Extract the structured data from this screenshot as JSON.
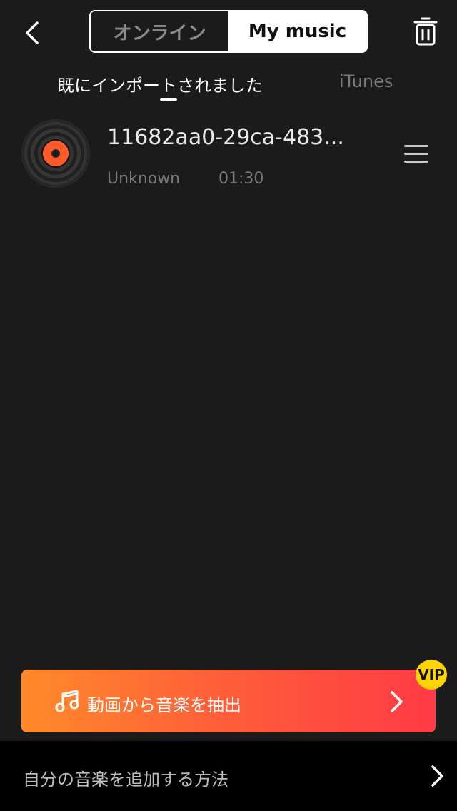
{
  "header": {
    "segment": {
      "online_label": "オンライン",
      "my_music_label": "My music"
    }
  },
  "subtabs": {
    "imported_label": "既にインポートされました",
    "itunes_label": "iTunes"
  },
  "tracks": [
    {
      "title": "11682aa0-29ca-483...",
      "artist": "Unknown",
      "duration": "01:30"
    }
  ],
  "extract": {
    "label": "動画から音楽を抽出",
    "badge": "VIP",
    "accent_from": "#ff8a2a",
    "accent_to": "#ff3b45"
  },
  "footer": {
    "help_label": "自分の音楽を追加する方法"
  }
}
